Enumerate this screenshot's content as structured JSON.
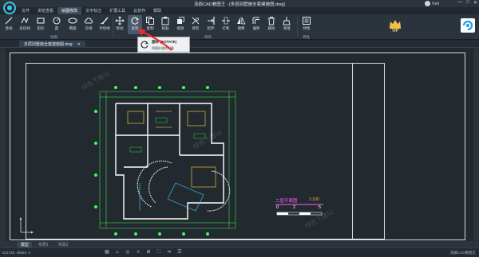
{
  "window": {
    "title": "浩辰CAD看图王 - [多层别墅施全套建施图.dwg]",
    "user_name": "Keit",
    "controls": [
      "—",
      "□",
      "✕"
    ]
  },
  "menu": {
    "tabs": [
      "文件",
      "浏览查看",
      "绘图修改",
      "文字标注",
      "扩展工具",
      "云协作",
      "帮助"
    ],
    "active_index": 2
  },
  "ribbon": {
    "tools": [
      {
        "label": "直线",
        "icon": "line-icon"
      },
      {
        "label": "多段线",
        "icon": "polyline-icon"
      },
      {
        "label": "矩形",
        "icon": "rectangle-icon"
      },
      {
        "label": "圆",
        "icon": "circle-icon"
      },
      {
        "label": "椭圆",
        "icon": "ellipse-icon"
      },
      {
        "label": "云线",
        "icon": "cloud-icon"
      },
      {
        "label": "手绘线",
        "icon": "freehand-icon"
      },
      {
        "label": "移动",
        "icon": "move-icon"
      },
      {
        "label": "旋转",
        "icon": "rotate-icon"
      },
      {
        "label": "复制",
        "icon": "copy-icon"
      },
      {
        "label": "粘贴",
        "icon": "paste-icon"
      },
      {
        "label": "缩放",
        "icon": "scale-icon"
      },
      {
        "label": "修剪",
        "icon": "trim-icon"
      },
      {
        "label": "延伸",
        "icon": "extend-icon"
      },
      {
        "label": "打断",
        "icon": "break-icon"
      },
      {
        "label": "镜像",
        "icon": "mirror-icon"
      },
      {
        "label": "偏移",
        "icon": "offset-icon"
      },
      {
        "label": "删除",
        "icon": "delete-icon"
      },
      {
        "label": "清理",
        "icon": "purge-icon"
      },
      {
        "label": "特性",
        "icon": "properties-icon"
      }
    ],
    "groups": [
      "绘图",
      "修改",
      "特性"
    ],
    "vip_label": "VIP"
  },
  "tooltip": {
    "name": "旋转 (ROTATE)",
    "description": "将图形旋转对象"
  },
  "document": {
    "tab_label": "多层别墅施全套建施图.dwg",
    "tab_close": "✕"
  },
  "drawing": {
    "plan_title": "二层平面图",
    "plan_scale": "1:100",
    "scale_ticks": [
      "0",
      "2",
      "5"
    ],
    "watermarks": [
      "绿色下载站",
      "绿色下载站",
      "绿色下载站"
    ]
  },
  "bottom_tabs": [
    "模型",
    "布局1",
    "布局2"
  ],
  "bottom_active": 0,
  "status": {
    "coords": "621735, 48693, 0",
    "brand": "浩辰CAD看图王"
  },
  "colors": {
    "ribbon_bg": "#2b333c",
    "canvas_bg": "#22292f",
    "accent_green": "#3cff5a",
    "wall_yellow": "#ffe23c",
    "dim_magenta": "#ff5aff"
  }
}
